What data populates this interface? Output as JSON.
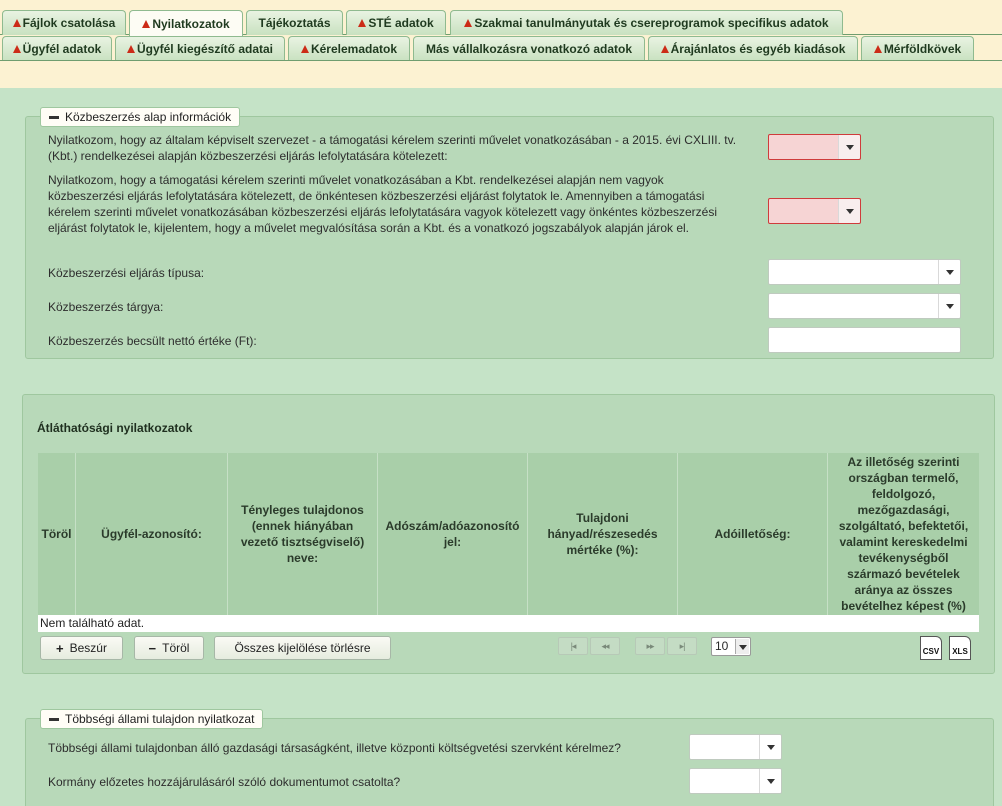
{
  "tabs_row1": [
    {
      "label": "Fájlok csatolása",
      "warn": true
    },
    {
      "label": "Nyilatkozatok",
      "warn": true,
      "active": true
    },
    {
      "label": "Tájékoztatás",
      "warn": false
    },
    {
      "label": "STÉ adatok",
      "warn": true
    },
    {
      "label": "Szakmai tanulmányutak és csereprogramok specifikus adatok",
      "warn": true
    }
  ],
  "tabs_row2": [
    {
      "label": "Ügyfél adatok",
      "warn": true
    },
    {
      "label": "Ügyfél kiegészítő adatai",
      "warn": true
    },
    {
      "label": "Kérelemadatok",
      "warn": true
    },
    {
      "label": "Más vállalkozásra vonatkozó adatok",
      "warn": false
    },
    {
      "label": "Árajánlatos és egyéb kiadások",
      "warn": true
    },
    {
      "label": "Mérföldkövek",
      "warn": true
    }
  ],
  "kozbeszerzes": {
    "legend": "Közbeszerzés alap információk",
    "q1": "Nyilatkozom, hogy az általam képviselt szervezet - a támogatási kérelem szerinti művelet vonatkozásában - a 2015. évi CXLIII. tv. (Kbt.) rendelkezései alapján közbeszerzési eljárás lefolytatására kötelezett:",
    "q2": "Nyilatkozom, hogy a támogatási kérelem szerinti művelet vonatkozásában a Kbt. rendelkezései alapján nem vagyok közbeszerzési eljárás lefolytatására kötelezett, de önkéntesen közbeszerzési eljárást folytatok le. Amennyiben a támogatási kérelem szerinti művelet vonatkozásában közbeszerzési eljárás lefolytatására vagyok kötelezett vagy önkéntes közbeszerzési eljárást folytatok le, kijelentem, hogy a művelet megvalósítása során a Kbt. és a vonatkozó jogszabályok alapján járok el.",
    "tipus": "Közbeszerzési eljárás típusa:",
    "targy": "Közbeszerzés tárgya:",
    "ertek": "Közbeszerzés becsült nettó értéke (Ft):"
  },
  "atlathatosagi": {
    "title": "Átláthatósági nyilatkozatok",
    "columns": [
      "Töröl",
      "Ügyfél-azonosító:",
      "Tényleges tulajdonos (ennek hiányában vezető tisztségviselő) neve:",
      "Adószám/adóazonosító jel:",
      "Tulajdoni hányad/részesedés mértéke (%):",
      "Adóilletőség:",
      "Az illetőség szerinti országban termelő, feldolgozó, mezőgazdasági, szolgáltató, befektetői, valamint kereskedelmi tevékenységből származó bevételek aránya az összes bevételhez képest (%)"
    ],
    "no_data": "Nem található adat.",
    "btn_insert": "Beszúr",
    "btn_delete": "Töröl",
    "btn_clear": "Összes kijelölése törlésre",
    "page_size": "10",
    "export_csv": "CSV",
    "export_xls": "XLS"
  },
  "tobbsegi": {
    "legend": "Többségi állami tulajdon nyilatkozat",
    "q1": "Többségi állami tulajdonban álló gazdasági társaságként, illetve központi költségvetési szervként kérelmez?",
    "q2": "Kormány előzetes hozzájárulásáról szóló dokumentumot csatolta?"
  },
  "icons": {
    "warn": "warning-triangle-icon",
    "collapse": "minus-icon",
    "insert": "plus-icon",
    "delete": "minus-icon",
    "first": "first-page-icon",
    "prev": "prev-page-icon",
    "next": "next-page-icon",
    "last": "last-page-icon"
  },
  "colors": {
    "bg": "#c5e3c7",
    "tabs_bg": "#fcf2d2",
    "error": "#f6d4d4",
    "warn": "#cc2b17"
  }
}
